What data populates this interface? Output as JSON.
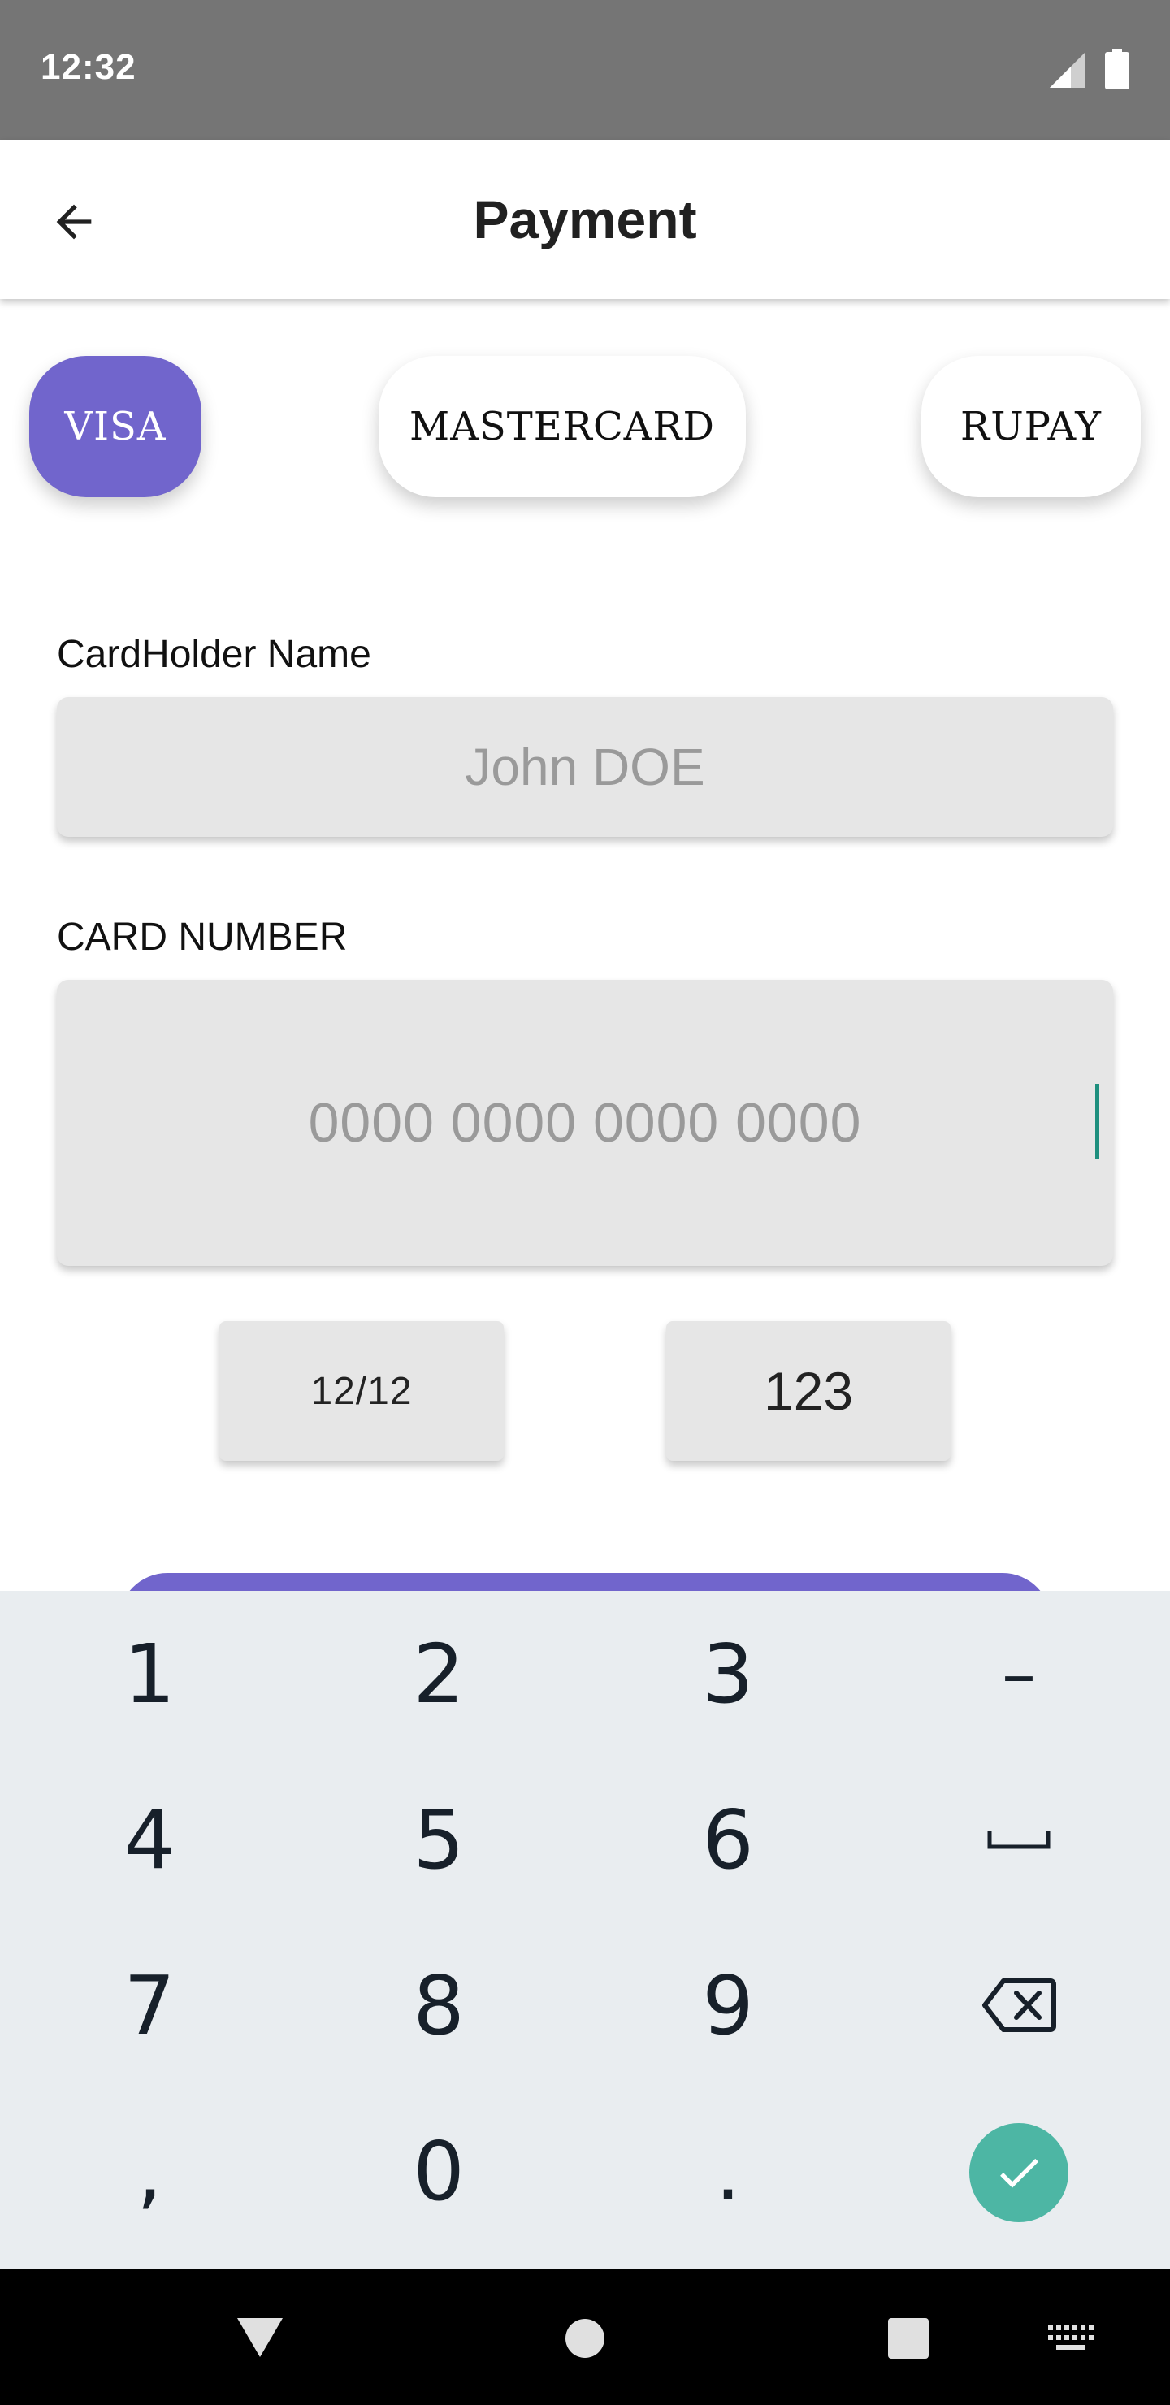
{
  "status_bar": {
    "time": "12:32"
  },
  "app_bar": {
    "title": "Payment"
  },
  "card_types": [
    {
      "label": "VISA",
      "selected": true
    },
    {
      "label": "MASTERCARD",
      "selected": false
    },
    {
      "label": "RUPAY",
      "selected": false
    }
  ],
  "form": {
    "cardholder_label": "CardHolder Name",
    "cardholder_placeholder": "John DOE",
    "card_number_label": "CARD NUMBER",
    "card_number_placeholder": "0000 0000 0000 0000",
    "expiry_value": "12/12",
    "cvv_value": "123"
  },
  "keyboard": {
    "keys": [
      "1",
      "2",
      "3",
      "–",
      "4",
      "5",
      "6",
      "␣",
      "7",
      "8",
      "9",
      "backspace",
      ",",
      "0",
      ".",
      "done"
    ]
  },
  "colors": {
    "accent": "#7165cc",
    "done_key": "#4db6a4",
    "cursor": "#1e8f7e",
    "keyboard_bg": "#e9edf0"
  }
}
